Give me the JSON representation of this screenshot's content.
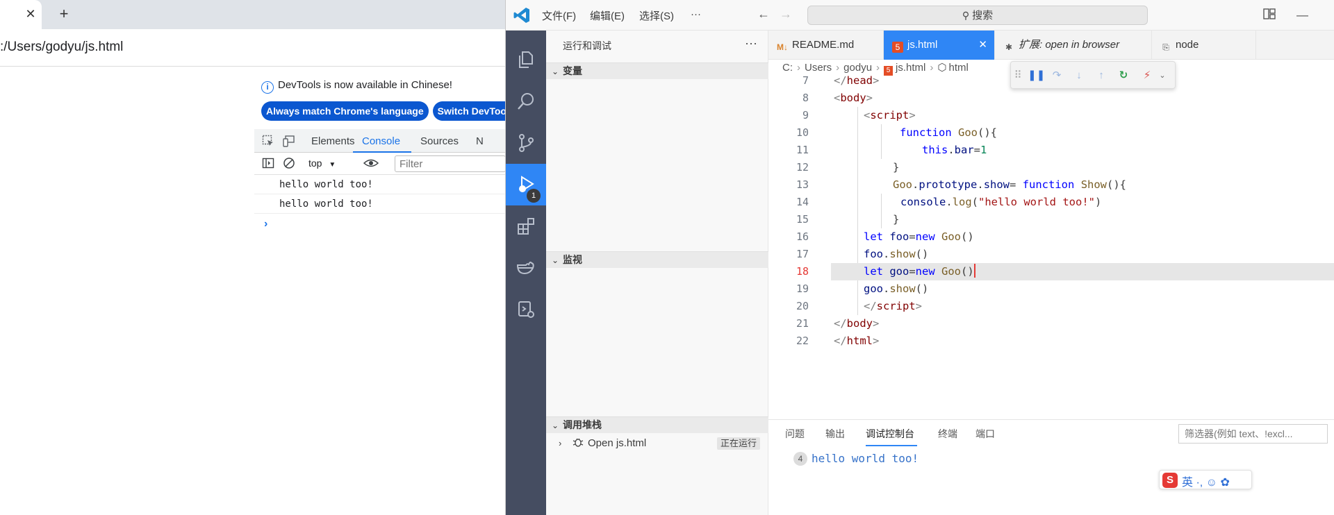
{
  "chrome": {
    "url": ":/Users/godyu/js.html",
    "tab_close": "✕",
    "new_tab": "+"
  },
  "devtools": {
    "banner": "DevTools is now available in Chinese!",
    "btn_match": "Always match Chrome's language",
    "btn_switch": "Switch DevTools",
    "tabs": [
      "Elements",
      "Console",
      "Sources",
      "N"
    ],
    "active_tab": "Console",
    "context": "top",
    "filter_placeholder": "Filter",
    "logs": [
      "hello world too!",
      "hello world too!"
    ],
    "prompt": "›"
  },
  "vscode": {
    "menus": [
      "文件(F)",
      "编辑(E)",
      "选择(S)",
      "···"
    ],
    "search_label": "搜索",
    "activity_badge": "1",
    "sidebar": {
      "title": "运行和调试",
      "more": "···",
      "sections": [
        "变量",
        "监视",
        "调用堆栈"
      ],
      "callstack_item": "Open js.html",
      "callstack_status": "正在运行"
    },
    "tabs": [
      "README.md",
      "js.html",
      "扩展: open in browser",
      "node"
    ],
    "tab_icons": {
      "readme": "M↓",
      "html": "5",
      "ext": "✱",
      "node": "⎘"
    },
    "breadcrumb": [
      "C:",
      "Users",
      "godyu",
      "js.html",
      "html"
    ],
    "current_line": 18,
    "code_lines": [
      7,
      8,
      9,
      10,
      11,
      12,
      13,
      14,
      15,
      16,
      17,
      18,
      19,
      20,
      21,
      22
    ],
    "code": {
      "l7a": "</",
      "l7b": "head",
      "l7c": ">",
      "l8a": "<",
      "l8b": "body",
      "l8c": ">",
      "l9a": "<",
      "l9b": "script",
      "l9c": ">",
      "l10a": "function",
      "l10b": "Goo",
      "l10c": "(){",
      "l11a": "this",
      "l11b": ".",
      "l11c": "bar",
      "l11d": "=",
      "l11e": "1",
      "l12a": "}",
      "l13a": "Goo",
      "l13b": ".",
      "l13c": "prototype",
      "l13d": ".",
      "l13e": "show",
      "l13f": "= ",
      "l13g": "function",
      "l13h": " ",
      "l13i": "Show",
      "l13j": "(){",
      "l14a": "console",
      "l14b": ".",
      "l14c": "log",
      "l14d": "(",
      "l14e": "\"hello world too!\"",
      "l14f": ")",
      "l15a": "}",
      "l16a": "let",
      "l16b": " foo",
      "l16c": "=",
      "l16d": "new",
      "l16e": " Goo",
      "l16f": "()",
      "l17a": "foo",
      "l17b": ".",
      "l17c": "show",
      "l17d": "()",
      "l18a": "let",
      "l18b": " goo",
      "l18c": "=",
      "l18d": "new",
      "l18e": " Goo",
      "l18f": "()",
      "l19a": "goo",
      "l19b": ".",
      "l19c": "show",
      "l19d": "()",
      "l20a": "</",
      "l20b": "script",
      "l20c": ">",
      "l21a": "</",
      "l21b": "body",
      "l21c": ">",
      "l22a": "</",
      "l22b": "html",
      "l22c": ">"
    },
    "panel": {
      "tabs": [
        "问题",
        "输出",
        "调试控制台",
        "终端",
        "端口"
      ],
      "filter_placeholder": "筛选器(例如 text、!excl...",
      "output_count": "4",
      "output": "hello world too!",
      "ime_text": "英 ·, ☺ ✿"
    },
    "colors": {
      "accent": "#2f86f5",
      "activity_bar": "#454d61",
      "current_line_number": "#e53935"
    }
  }
}
